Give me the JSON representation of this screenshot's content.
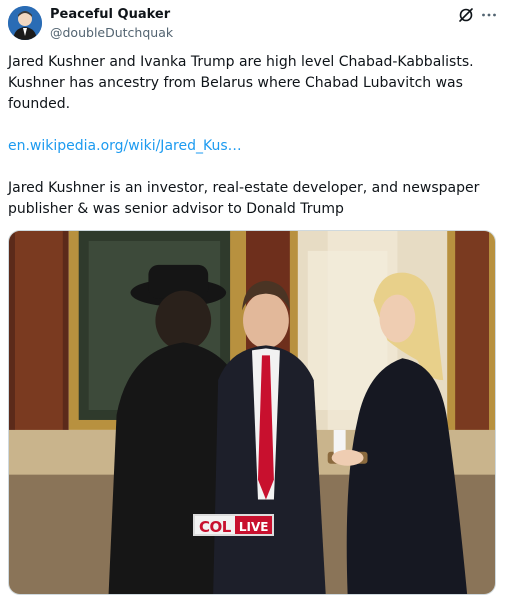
{
  "post": {
    "author": {
      "display_name": "Peaceful Quaker",
      "handle": "@doubleDutchquak",
      "avatar_icon": "user-avatar"
    },
    "actions": {
      "grok_icon": "grok-icon",
      "more_icon": "more-horizontal-icon"
    },
    "paragraph_1": "Jared Kushner and Ivanka Trump are high level Chabad-Kabbalists. Kushner has ancestry from Belarus where Chabad Lubavitch was founded.",
    "link_text": "en.wikipedia.org/wiki/Jared_Kus…",
    "paragraph_2": "Jared Kushner is an investor, real-estate developer, and newspaper publisher & was senior advisor to Donald Trump",
    "media": {
      "watermark_left": "COL",
      "watermark_right": "LIVE"
    }
  },
  "colors": {
    "link": "#1d9bf0",
    "secondary_text": "#536471",
    "watermark_red": "#c8102e"
  }
}
